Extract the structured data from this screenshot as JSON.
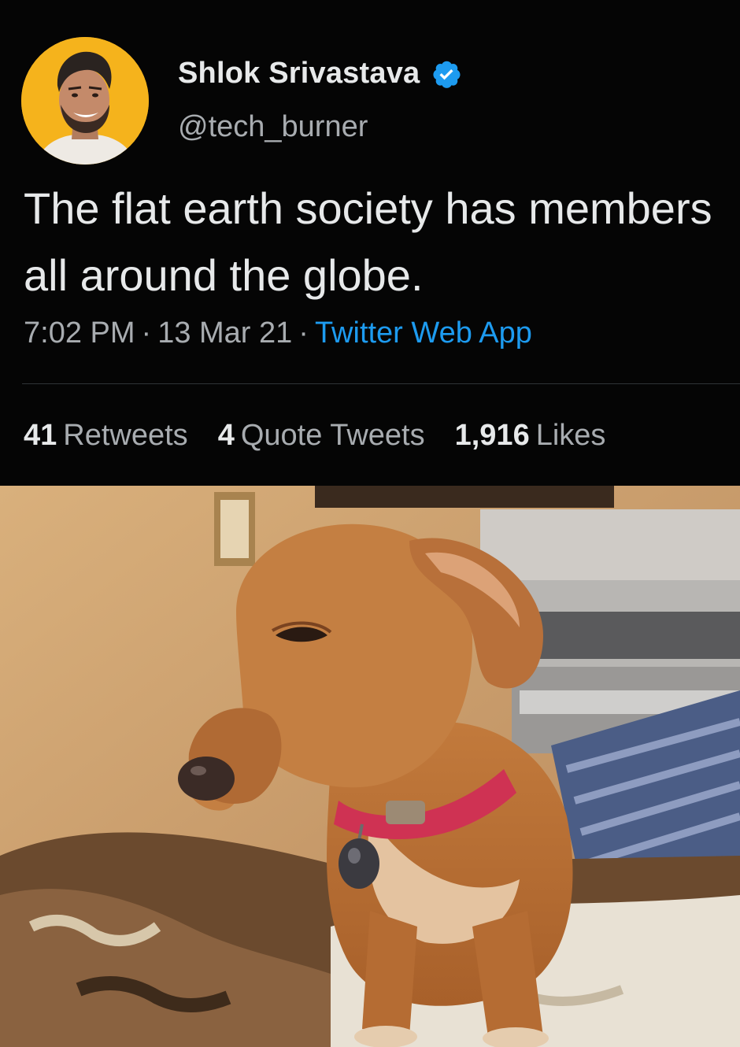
{
  "author": {
    "display_name": "Shlok Srivastava",
    "handle": "@tech_burner",
    "verified_icon": "verified-badge-icon",
    "avatar_bg": "#f5b31c"
  },
  "tweet": {
    "text": "The flat earth society has members all around the globe.",
    "time": "7:02 PM",
    "date": "13 Mar 21",
    "separator": "·",
    "source": "Twitter Web App"
  },
  "stats": {
    "retweets_count": "41",
    "retweets_label": "Retweets",
    "quotes_count": "4",
    "quotes_label": "Quote Tweets",
    "likes_count": "1,916",
    "likes_label": "Likes"
  },
  "colors": {
    "background": "#050505",
    "text": "#e7e9ea",
    "muted": "#a8acb0",
    "link": "#1d9bf0"
  },
  "media": {
    "description_icon": "dog-photo"
  }
}
